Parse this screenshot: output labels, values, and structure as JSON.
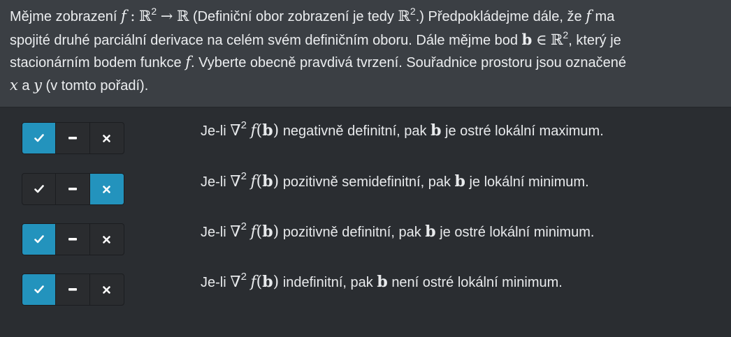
{
  "question": {
    "p1": "Mějme zobrazení",
    "f": "f",
    "colon": ":",
    "domain_set": "ℝ",
    "domain_exp": "2",
    "arrow": "→",
    "codomain_set": "ℝ",
    "p2": "(Definiční obor zobrazení je tedy",
    "def_set": "ℝ",
    "def_exp": "2",
    "p3": ".) Předpokládejme dále, že",
    "f2": "f",
    "p4": "ma",
    "p5": "spojité druhé parciální derivace na celém svém definičním oboru. Dále mějme bod",
    "b": "b",
    "in_sym": "∈",
    "b_set": "ℝ",
    "b_exp": "2",
    "p6": ", který je",
    "p7": "stacionárním bodem funkce",
    "f3": "f",
    "p8": ". Vyberte obecně pravdivá tvrzení. Souřadnice prostoru jsou označené",
    "x": "x",
    "and": "a",
    "y": "y",
    "p9": "(v tomto pořadí)."
  },
  "options": [
    {
      "prefix": "Je-li",
      "nabla": "∇",
      "exp": "2",
      "f": "f",
      "lparen": "(",
      "b": "b",
      "rparen": ")",
      "mid": "negativně definitní, pak",
      "b2": "b",
      "suffix": "je ostré lokální maximum.",
      "selected": "true"
    },
    {
      "prefix": "Je-li",
      "nabla": "∇",
      "exp": "2",
      "f": "f",
      "lparen": "(",
      "b": "b",
      "rparen": ")",
      "mid": "pozitivně semidefinitní, pak",
      "b2": "b",
      "suffix": "je lokální minimum.",
      "selected": "false"
    },
    {
      "prefix": "Je-li",
      "nabla": "∇",
      "exp": "2",
      "f": "f",
      "lparen": "(",
      "b": "b",
      "rparen": ")",
      "mid": "pozitivně definitní, pak",
      "b2": "b",
      "suffix": "je ostré lokální minimum.",
      "selected": "true"
    },
    {
      "prefix": "Je-li",
      "nabla": "∇",
      "exp": "2",
      "f": "f",
      "lparen": "(",
      "b": "b",
      "rparen": ")",
      "mid": "indefinitní, pak",
      "b2": "b",
      "suffix": "není ostré lokální minimum.",
      "selected": "true"
    }
  ],
  "icons": {
    "true": "check-icon",
    "neutral": "dash-icon",
    "false": "x-icon"
  },
  "colors": {
    "active": "#2393bd",
    "header_bg": "#3b3f44",
    "body_bg": "#2a2d31"
  }
}
